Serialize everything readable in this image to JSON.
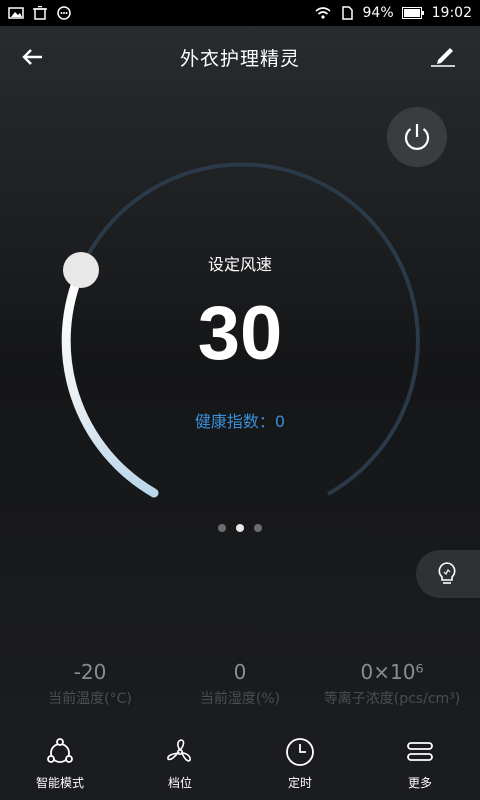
{
  "status_bar": {
    "battery": "94%",
    "time": "19:02"
  },
  "header": {
    "title": "外衣护理精灵"
  },
  "dial": {
    "label": "设定风速",
    "value": "30",
    "health": "健康指数：0"
  },
  "pager": {
    "count": 3,
    "active_index": 1
  },
  "readings": [
    {
      "value": "-20",
      "label": "当前温度(°C)"
    },
    {
      "value": "0",
      "label": "当前湿度(%)"
    },
    {
      "value": "0×10⁶",
      "label": "等离子浓度(pcs/cm³)"
    }
  ],
  "bottom_nav": [
    {
      "label": "智能模式",
      "icon": "smart-mode-icon"
    },
    {
      "label": "档位",
      "icon": "fan-icon"
    },
    {
      "label": "定时",
      "icon": "clock-icon"
    },
    {
      "label": "更多",
      "icon": "menu-icon"
    }
  ],
  "colors": {
    "accent_blue": "#3a8fd9",
    "track": "#2a3a48"
  }
}
